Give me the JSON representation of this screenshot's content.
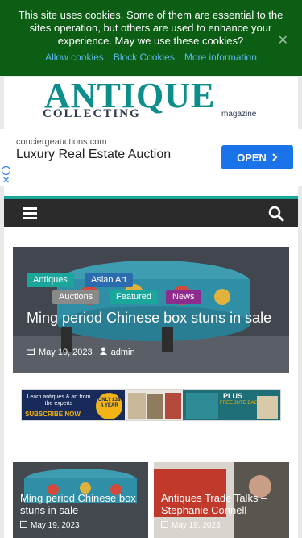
{
  "cookie": {
    "message": "This site uses cookies. Some of them are essential to the sites operation, but others are used to enhance your experience. May we use these cookies?",
    "allow": "Allow cookies",
    "block": "Block Cookies",
    "more": "More information",
    "close_icon": "close-icon"
  },
  "logo": {
    "main": "ANTIQUE",
    "sub": "COLLECTING",
    "mag": "magazine"
  },
  "ad": {
    "domain": "conciergeauctions.com",
    "title": "Luxury Real Estate Auction",
    "button": "OPEN",
    "button_icon": "chevron-right-icon"
  },
  "nav": {
    "menu_icon": "hamburger-menu-icon",
    "search_icon": "search-icon",
    "accent": "#1ba69c"
  },
  "hero": {
    "tags": [
      "Antiques",
      "Asian Art",
      "Auctions",
      "Featured",
      "News"
    ],
    "title": "Ming period Chinese box stuns in sale",
    "date": "May 19, 2023",
    "author": "admin"
  },
  "banner": {
    "learn": "Learn antiques & art from the experts",
    "subscribe": "SUBSCRIBE NOW",
    "badge": "ONLY £38 A YEAR",
    "plus": "PLUS",
    "free": "FREE JUTE BAG"
  },
  "cards": [
    {
      "title": "Ming period Chinese box stuns in sale",
      "date": "May 19, 2023"
    },
    {
      "title": "Antiques Trade Talks – Stephanie Connell",
      "date": "May 19, 2023"
    }
  ]
}
